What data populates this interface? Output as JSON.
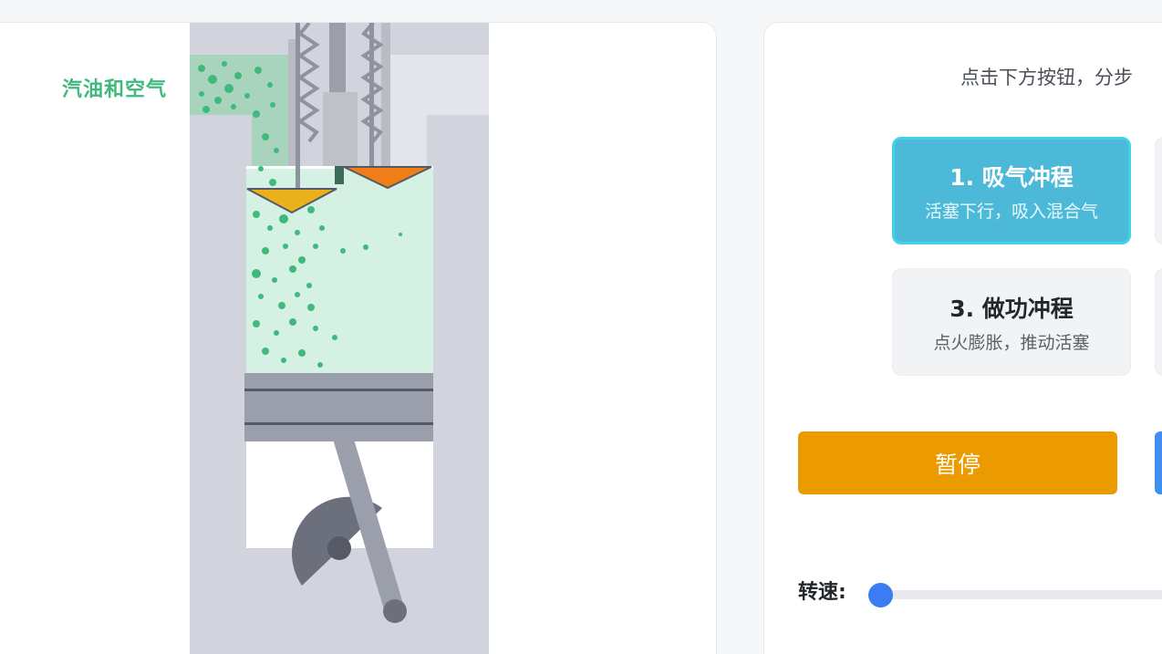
{
  "engine": {
    "fuel_label": "汽油和空气"
  },
  "controls": {
    "hint": "点击下方按钮，分步",
    "strokes": [
      {
        "title": "1. 吸气冲程",
        "desc": "活塞下行，吸入混合气",
        "active": true
      },
      {
        "title": "",
        "desc": "",
        "active": false
      },
      {
        "title": "3. 做功冲程",
        "desc": "点火膨胀，推动活塞",
        "active": false
      },
      {
        "title": "",
        "desc": "",
        "active": false
      }
    ],
    "pause_label": "暂停",
    "next_label": "",
    "speed_label": "转速:",
    "speed_value": 0
  },
  "colors": {
    "fuel": "#3fb97c",
    "active_card": "#4cb9d9",
    "pause_button": "#eb9a00",
    "next_button": "#3f8ff0",
    "slider": "#3b7cf2"
  }
}
